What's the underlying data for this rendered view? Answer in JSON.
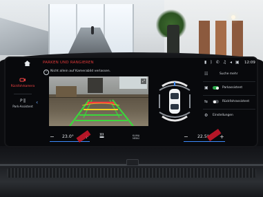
{
  "screen": {
    "title": "PARKEN UND RANGIEREN",
    "notice": "Nicht allein auf Kamerabild verlassen.",
    "time": "12:09",
    "status_icons": [
      "signal-icon",
      "bluetooth-icon",
      "phone-icon",
      "music-icon",
      "volume-icon",
      "media-icon"
    ]
  },
  "left_nav": {
    "items": [
      {
        "label": "Rückfahrkamera",
        "icon": "reverse-camera-icon",
        "active": true
      },
      {
        "label": "Park-Assistent",
        "icon": "parking-assist-icon",
        "active": false
      }
    ]
  },
  "right_panel": {
    "search_label": "Suche mehr",
    "items": [
      {
        "label": "Parkassistent",
        "icon": "park-icon",
        "toggle": true
      },
      {
        "label": "Rückfahrassistent",
        "icon": "reverse-assist-icon",
        "toggle": false
      },
      {
        "label": "Einstellungen",
        "icon": "gear-icon"
      }
    ]
  },
  "climate": {
    "left_temp": "23.0",
    "right_temp": "22.5",
    "unit": "°",
    "minus": "−",
    "plus": "+",
    "center_label_1": "KLIMA",
    "center_label_2": "MENÜ"
  },
  "camera_view": {
    "expand_icon": "expand-icon"
  },
  "colors": {
    "title": "#e03a3a",
    "accent": "#3d8cff",
    "toggle_on": "#2ca84a",
    "guide_red": "#ff3b3b",
    "guide_yellow": "#ffd21f",
    "guide_green": "#3bd83b"
  }
}
